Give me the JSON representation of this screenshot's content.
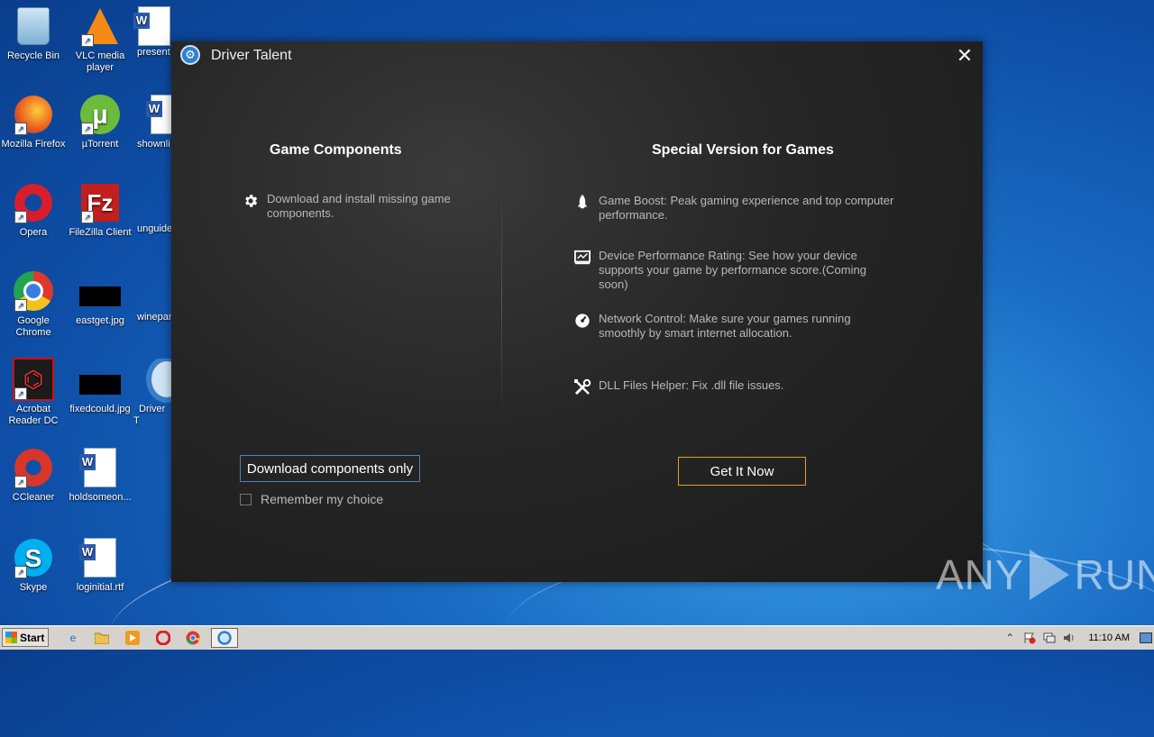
{
  "desktop": {
    "icons": [
      {
        "label": "Recycle Bin"
      },
      {
        "label": "VLC media player"
      },
      {
        "label": "present"
      },
      {
        "label": "Mozilla Firefox"
      },
      {
        "label": "µTorrent"
      },
      {
        "label": "shownli"
      },
      {
        "label": "Opera"
      },
      {
        "label": "FileZilla Client"
      },
      {
        "label": "unguide"
      },
      {
        "label": "Google Chrome"
      },
      {
        "label": "eastget.jpg"
      },
      {
        "label": "winepar"
      },
      {
        "label": "Acrobat Reader DC"
      },
      {
        "label": "fixedcould.jpg"
      },
      {
        "label": "Driver T"
      },
      {
        "label": "CCleaner"
      },
      {
        "label": "holdsomeon..."
      },
      {
        "label": "Skype"
      },
      {
        "label": "loginitial.rtf"
      }
    ]
  },
  "dialog": {
    "title": "Driver Talent",
    "close_glyph": "✕",
    "left": {
      "heading": "Game Components",
      "features": [
        {
          "icon": "gear-icon",
          "text": "Download and install missing game components."
        }
      ],
      "button_label": "Download components only",
      "remember_label": "Remember my choice",
      "remember_checked": false
    },
    "right": {
      "heading": "Special Version for Games",
      "features": [
        {
          "icon": "rocket-icon",
          "text": "Game Boost: Peak gaming experience and top computer performance."
        },
        {
          "icon": "monitor-chart-icon",
          "text": "Device Performance Rating: See how your device supports your game by performance score.(Coming soon)"
        },
        {
          "icon": "speedometer-icon",
          "text": "Network Control: Make sure your games running smoothly by smart internet allocation."
        },
        {
          "icon": "tools-icon",
          "text": "DLL Files Helper: Fix .dll file issues."
        }
      ],
      "button_label": "Get It Now"
    },
    "accent_color": "#e39b2e"
  },
  "watermark": {
    "left": "ANY",
    "right": "RUN"
  },
  "taskbar": {
    "start_label": "Start",
    "clock": "11:10 AM"
  }
}
